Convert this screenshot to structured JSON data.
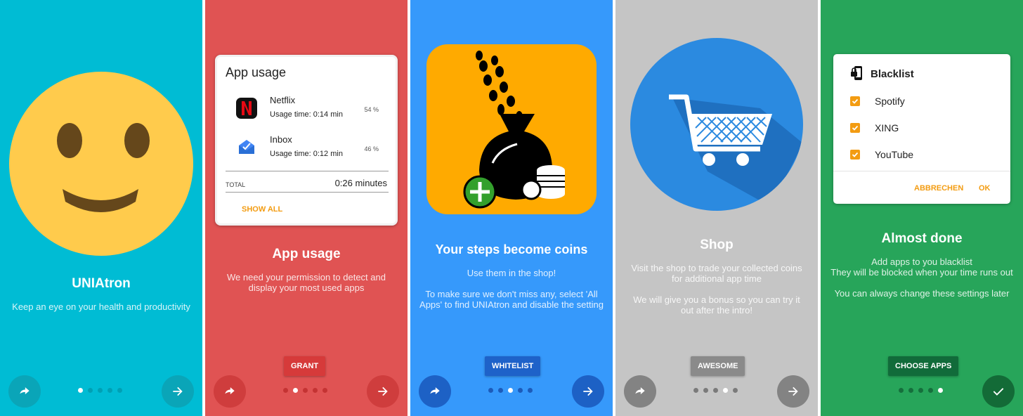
{
  "colors": {
    "screen1_bg": "#00bcd4",
    "screen2_bg": "#e05353",
    "screen3_bg": "#3699fb",
    "screen4_bg": "#c5c5c5",
    "screen5_bg": "#27a55a",
    "accent_orange": "#f39c12"
  },
  "screens": [
    {
      "title": "UNIAtron",
      "description": "Keep an eye on your health and productivity",
      "active_dot": 1,
      "icons": [
        "smiley-face-icon",
        "skip-icon",
        "arrow-right-icon"
      ]
    },
    {
      "title": "App usage",
      "description": "We need your permission to detect and display your most used apps",
      "action": "GRANT",
      "active_dot": 2,
      "card": {
        "title": "App usage",
        "apps": [
          {
            "name": "Netflix",
            "usage": "Usage time: 0:14 min",
            "percent": "54 %",
            "icon": "netflix-icon"
          },
          {
            "name": "Inbox",
            "usage": "Usage time: 0:12 min",
            "percent": "46 %",
            "icon": "inbox-icon"
          }
        ],
        "total_label": "TOTAL",
        "total_value": "0:26 minutes",
        "show_all": "SHOW ALL"
      }
    },
    {
      "title": "Your steps become coins",
      "line1": "Use them in the shop!",
      "line2": "To make sure we don't miss any, select 'All Apps' to find UNIAtron and disable the setting",
      "action": "WHITELIST",
      "active_dot": 3,
      "icons": [
        "footsteps-money-bag-icon",
        "plus-icon"
      ]
    },
    {
      "title": "Shop",
      "line1": "Visit the shop to trade your collected coins for additional app time",
      "line2": "We will give you a bonus so you can try it out after the intro!",
      "action": "AWESOME",
      "active_dot": 4,
      "icons": [
        "shopping-cart-icon"
      ]
    },
    {
      "title": "Almost done",
      "line1": "Add apps to you blacklist",
      "line2": "They will be blocked when your time runs out",
      "line3": "You can always change these settings later",
      "action": "CHOOSE APPS",
      "active_dot": 5,
      "dialog": {
        "title": "Blacklist",
        "items": [
          "Spotify",
          "XING",
          "YouTube"
        ],
        "cancel": "ABBRECHEN",
        "ok": "OK"
      },
      "icons": [
        "phone-lock-icon",
        "checkmark-icon"
      ]
    }
  ]
}
